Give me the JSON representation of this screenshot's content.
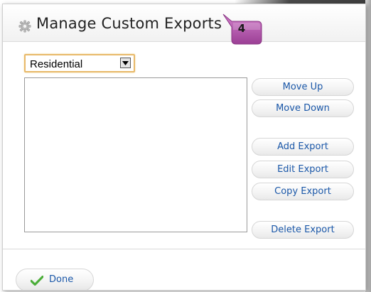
{
  "dialog": {
    "title": "Manage Custom Exports",
    "step_badge": "4",
    "title_icon": "gear-icon"
  },
  "export_type_select": {
    "value": "Residential"
  },
  "actions": {
    "move_up": "Move Up",
    "move_down": "Move Down",
    "add_export": "Add Export",
    "edit_export": "Edit Export",
    "copy_export": "Copy Export",
    "delete_export": "Delete Export"
  },
  "footer": {
    "done_label": "Done",
    "done_icon": "checkmark-icon"
  },
  "colors": {
    "link_blue": "#1a57a8",
    "badge_purple": "#b45dae",
    "select_border": "#e8b96a",
    "check_green": "#4cae3a"
  }
}
